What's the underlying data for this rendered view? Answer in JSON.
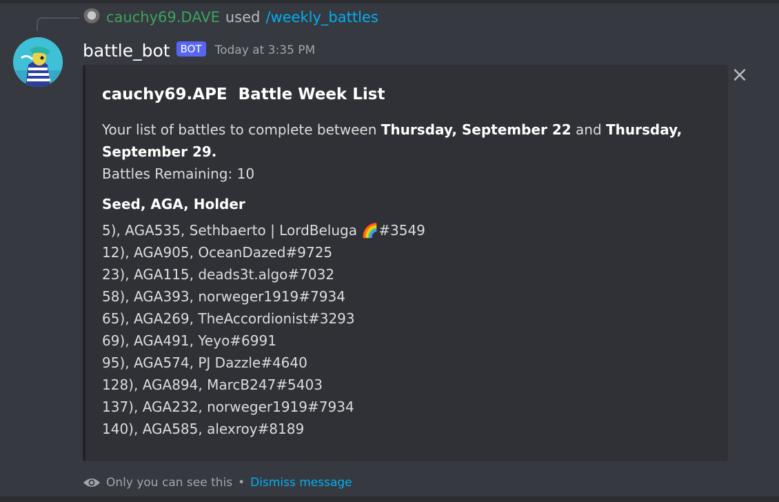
{
  "reply": {
    "user": "cauchy69.DAVE",
    "used_text": "used",
    "command": "/weekly_battles"
  },
  "message": {
    "author": "battle_bot",
    "bot_tag": "BOT",
    "timestamp": "Today at 3:35 PM"
  },
  "embed": {
    "title": "cauchy69.APE  Battle Week List",
    "desc_prefix": "Your list of battles to complete between ",
    "start_date": "Thursday, September 22",
    "desc_and": " and ",
    "end_date": "Thursday, September 29.",
    "remaining": "Battles Remaining: 10",
    "field_name": "Seed, AGA, Holder",
    "battles": [
      "5), AGA535, Sethbaerto | LordBeluga 🌈#3549",
      "12), AGA905, OceanDazed#9725",
      "23), AGA115, deads3t.algo#7032",
      "58), AGA393, norweger1919#7934",
      "65), AGA269, TheAccordionist#3293",
      "69), AGA491, Yeyo#6991",
      "95), AGA574, PJ Dazzle#4640",
      "128), AGA894, MarcB247#5403",
      "137), AGA232, norweger1919#7934",
      "140), AGA585, alexroy#8189"
    ]
  },
  "close_icon": "×",
  "footer": {
    "visibility_text": "Only you can see this",
    "separator": "•",
    "dismiss_label": "Dismiss message"
  },
  "colors": {
    "background": "#36393f",
    "embed_bg": "#2f3136",
    "bot_tag": "#5865f2",
    "link": "#00aff4",
    "reply_user": "#3ba55d"
  },
  "icons": [
    "close-icon",
    "eye-icon",
    "avatar"
  ]
}
